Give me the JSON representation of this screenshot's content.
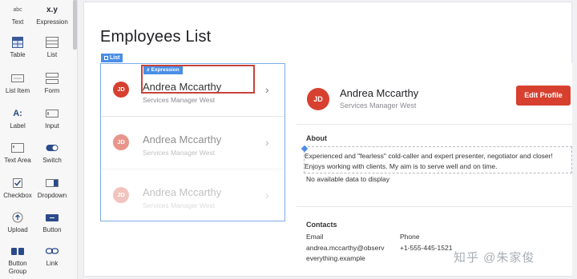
{
  "toolbox": {
    "items": [
      {
        "label": "Text",
        "icon": "text-icon"
      },
      {
        "label": "Expression",
        "icon": "expression-icon",
        "glyph": "x.y"
      },
      {
        "label": "Table",
        "icon": "table-icon"
      },
      {
        "label": "List",
        "icon": "list-icon"
      },
      {
        "label": "List Item",
        "icon": "list-item-icon"
      },
      {
        "label": "Form",
        "icon": "form-icon"
      },
      {
        "label": "Label",
        "icon": "label-icon",
        "glyph": "A:"
      },
      {
        "label": "Input",
        "icon": "input-icon"
      },
      {
        "label": "Text Area",
        "icon": "text-area-icon"
      },
      {
        "label": "Switch",
        "icon": "switch-icon"
      },
      {
        "label": "Checkbox",
        "icon": "checkbox-icon"
      },
      {
        "label": "Dropdown",
        "icon": "dropdown-icon"
      },
      {
        "label": "Upload",
        "icon": "upload-icon"
      },
      {
        "label": "Button",
        "icon": "button-icon"
      },
      {
        "label": "Button Group",
        "icon": "button-group-icon"
      },
      {
        "label": "Link",
        "icon": "link-icon"
      }
    ]
  },
  "page": {
    "title": "Employees List",
    "list_tag": "List",
    "expression_tag": "Expression"
  },
  "list": [
    {
      "initials": "JD",
      "name": "Andrea Mccarthy",
      "subtitle": "Services Manager West",
      "opacity": 1.0
    },
    {
      "initials": "JD",
      "name": "Andrea Mccarthy",
      "subtitle": "Services Manager West",
      "opacity": 0.55
    },
    {
      "initials": "JD",
      "name": "Andrea Mccarthy",
      "subtitle": "Services Manager West",
      "opacity": 0.3
    }
  ],
  "detail": {
    "initials": "JD",
    "name": "Andrea Mccarthy",
    "subtitle": "Services Manager West",
    "edit_button": "Edit Profile",
    "about_title": "About",
    "about_text": "Experienced and \"fearless\" cold-caller and expert presenter, negotiator and closer! Enjoys working with clients. My aim is to serve well and on time.",
    "no_data": "No available data to display",
    "contacts_title": "Contacts",
    "email_label": "Email",
    "email_value_1": "andrea.mccarthy@observ",
    "email_value_2": "everything.example",
    "phone_label": "Phone",
    "phone_value": "+1-555-445-1521"
  },
  "watermark": "知乎 @朱家俊",
  "colors": {
    "accent_red": "#d7402f",
    "selection_blue": "#4a8ee6"
  }
}
